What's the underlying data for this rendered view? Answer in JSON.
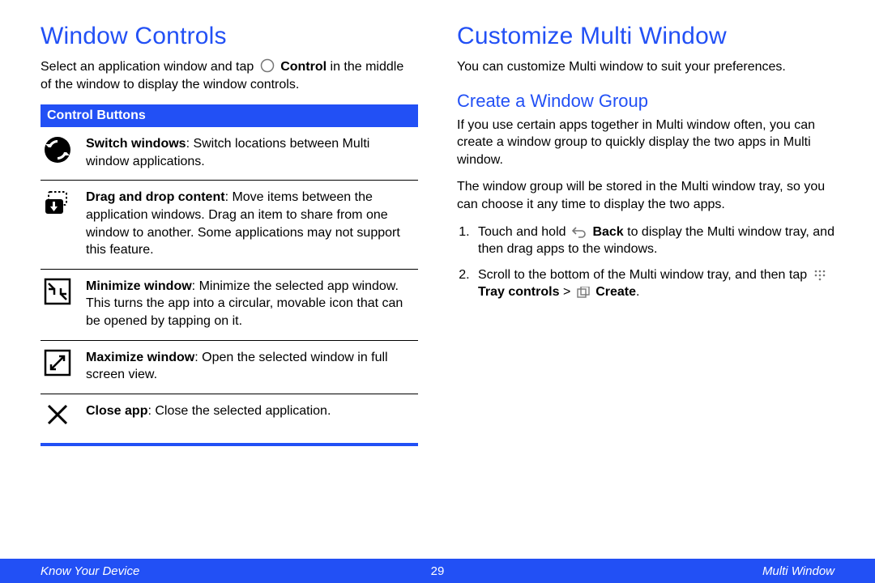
{
  "left": {
    "heading": "Window Controls",
    "intro_pre": "Select an application window and tap ",
    "intro_bold": "Control",
    "intro_post": " in the middle of the window to display the window controls.",
    "section_header": "Control Buttons",
    "buttons": [
      {
        "icon": "switch",
        "bold": "Switch windows",
        "desc": ": Switch locations between Multi window applications."
      },
      {
        "icon": "dragdrop",
        "bold": "Drag and drop content",
        "desc": ": Move items between the application windows. Drag an item to share from one window to another. Some applications may not support this feature."
      },
      {
        "icon": "minimize",
        "bold": "Minimize window",
        "desc": ": Minimize the selected app window. This turns the app into a circular, movable icon that can be opened by tapping on it."
      },
      {
        "icon": "maximize",
        "bold": "Maximize window",
        "desc": ": Open the selected window in full screen view."
      },
      {
        "icon": "close",
        "bold": "Close app",
        "desc": ": Close the selected application."
      }
    ]
  },
  "right": {
    "heading": "Customize Multi Window",
    "intro": "You can customize Multi window to suit your preferences.",
    "subheading": "Create a Window Group",
    "p1": "If you use certain apps together in Multi window often, you can create a window group to quickly display the two apps in Multi window.",
    "p2": "The window group will be stored in the Multi window tray, so you can choose it any time to display the two apps.",
    "step1_pre": "Touch and hold ",
    "step1_bold": "Back",
    "step1_post": " to display the Multi window tray, and then drag apps to the windows.",
    "step2_pre": "Scroll to the bottom of the Multi window tray, and then tap ",
    "step2_b1": "Tray controls",
    "step2_mid": " > ",
    "step2_b2": "Create",
    "step2_post": "."
  },
  "footer": {
    "left": "Know Your Device",
    "page": "29",
    "right": "Multi Window"
  }
}
